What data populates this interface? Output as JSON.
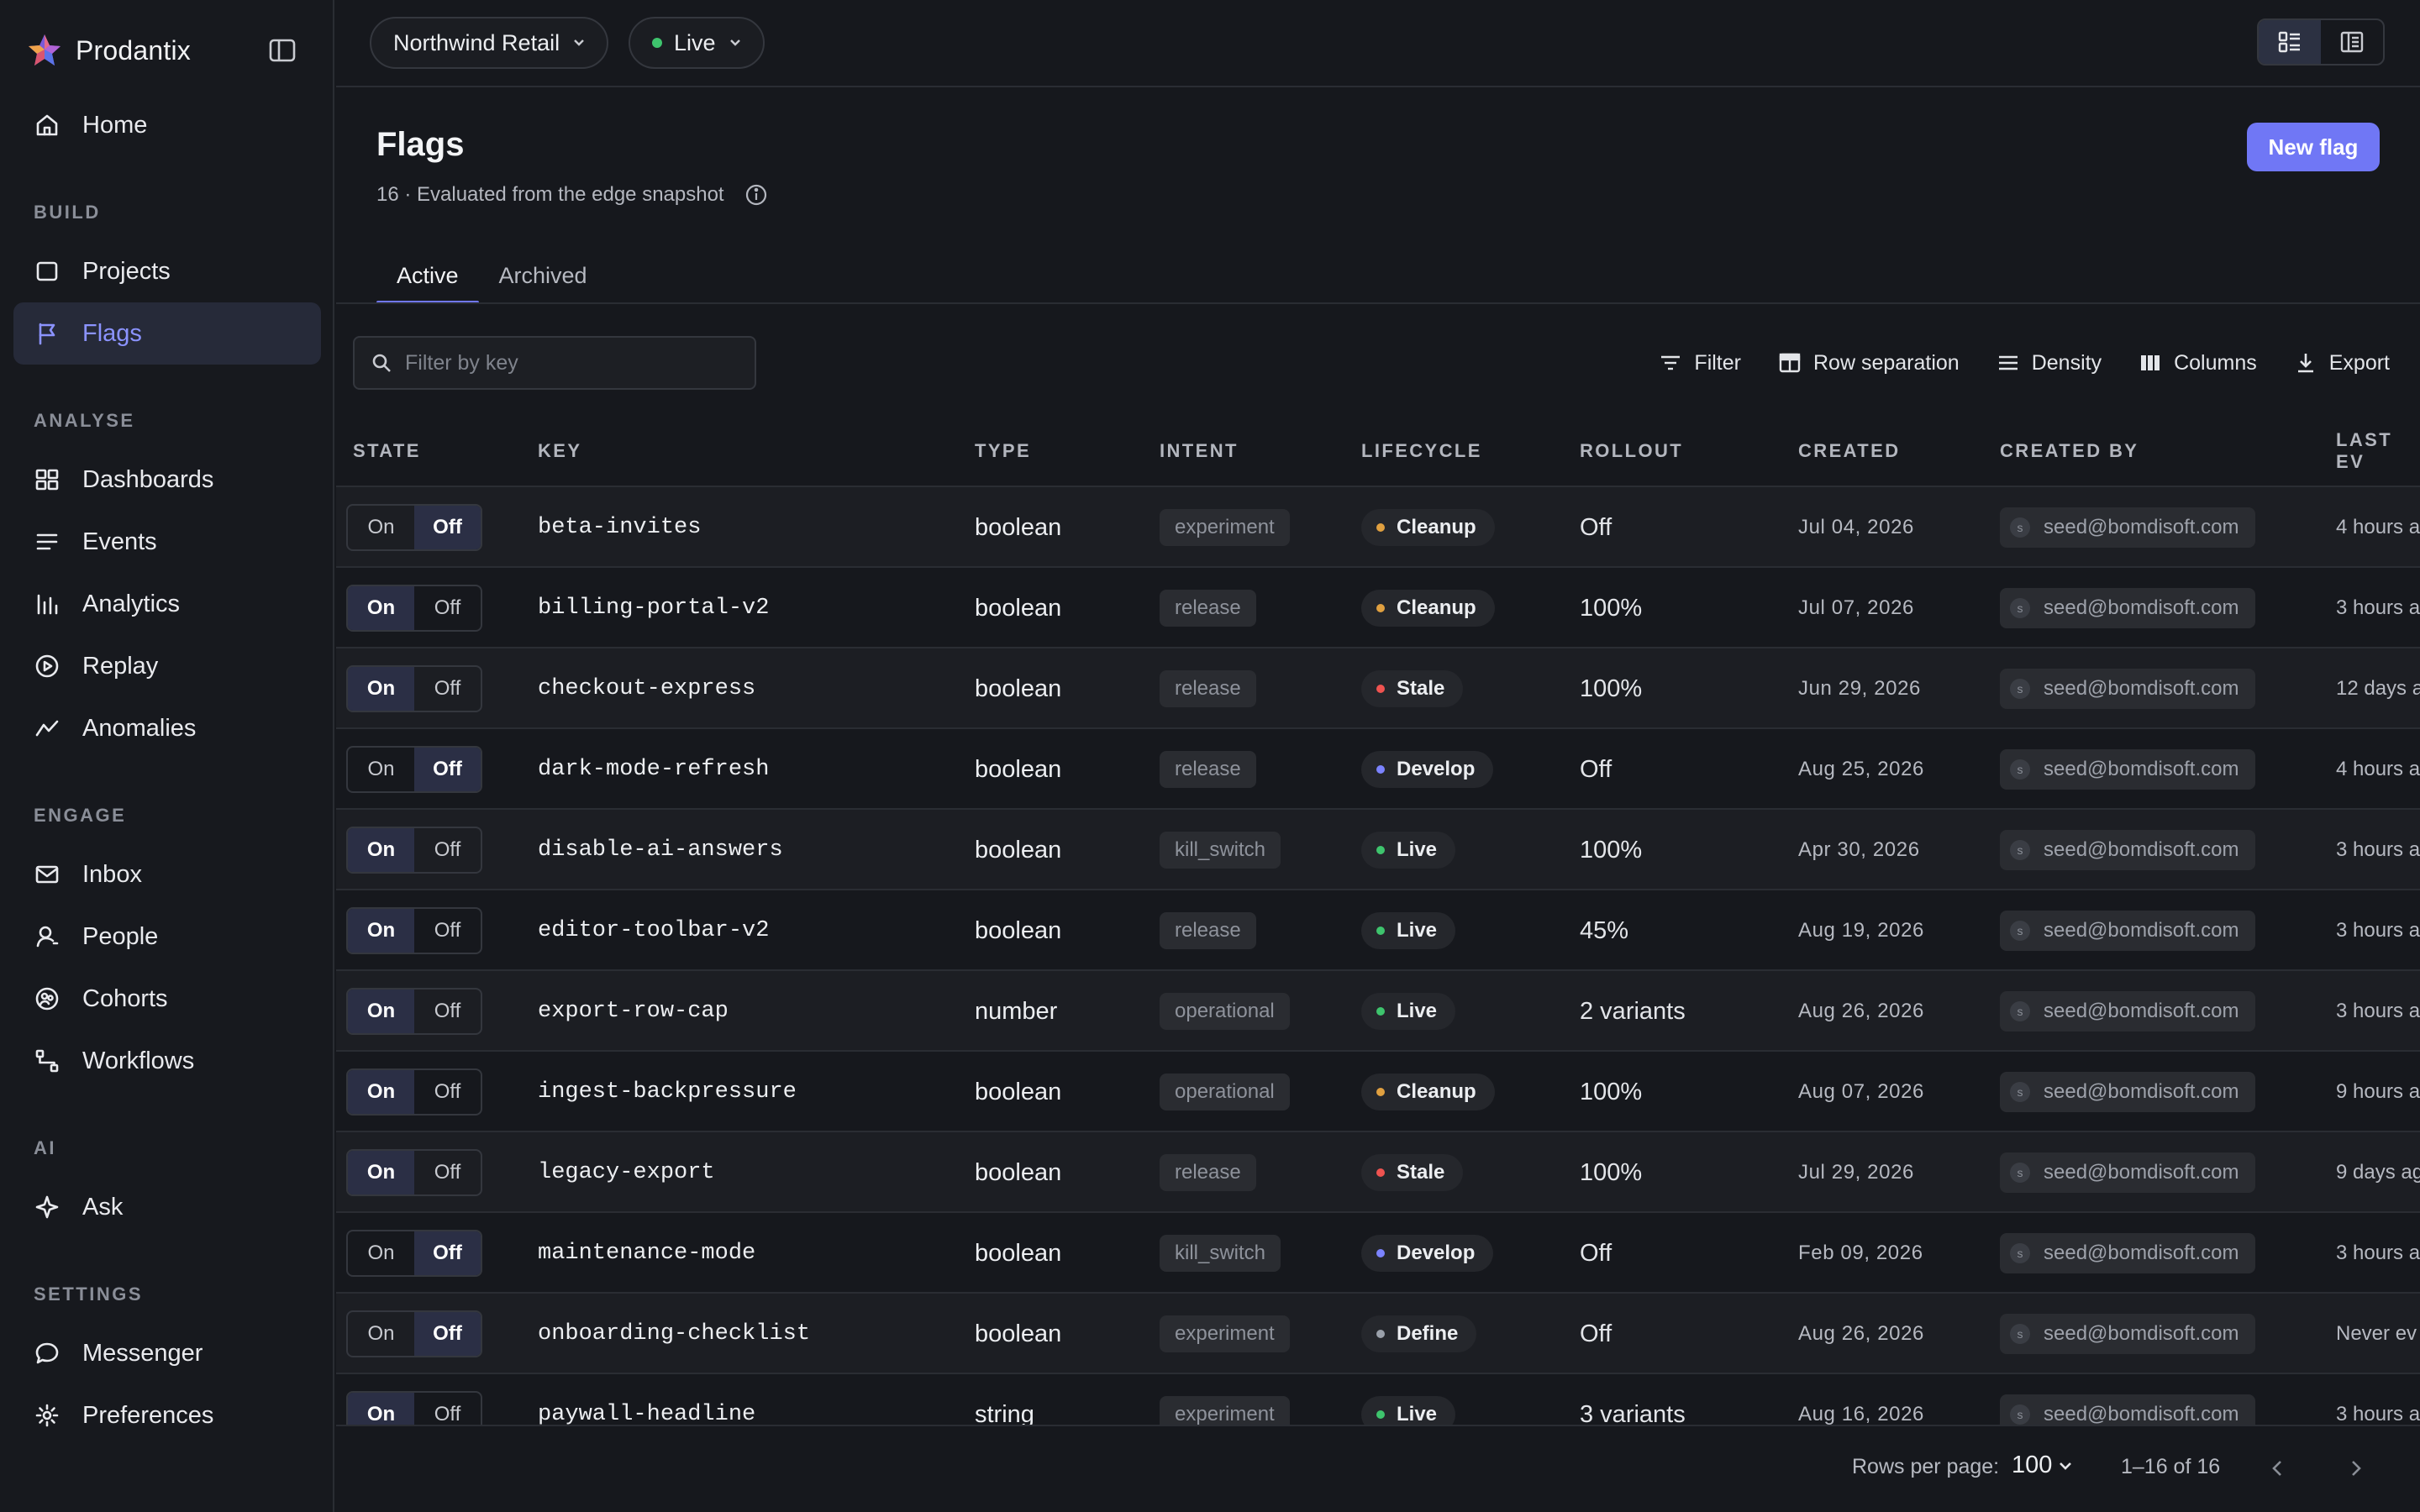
{
  "app": {
    "name": "Prodantix"
  },
  "sidebar": {
    "items": [
      {
        "label": "Home",
        "icon": "home-icon",
        "section": null
      },
      {
        "section_label": "BUILD"
      },
      {
        "label": "Projects",
        "icon": "square-icon"
      },
      {
        "label": "Flags",
        "icon": "flag-icon",
        "active": true
      },
      {
        "section_label": "ANALYSE"
      },
      {
        "label": "Dashboards",
        "icon": "dashboard-icon"
      },
      {
        "label": "Events",
        "icon": "list-icon"
      },
      {
        "label": "Analytics",
        "icon": "bar-chart-icon"
      },
      {
        "label": "Replay",
        "icon": "play-circle-icon"
      },
      {
        "label": "Anomalies",
        "icon": "trend-icon"
      },
      {
        "section_label": "ENGAGE"
      },
      {
        "label": "Inbox",
        "icon": "mail-icon"
      },
      {
        "label": "People",
        "icon": "person-icon"
      },
      {
        "label": "Cohorts",
        "icon": "cohort-icon"
      },
      {
        "label": "Workflows",
        "icon": "workflow-icon"
      },
      {
        "section_label": "AI"
      },
      {
        "label": "Ask",
        "icon": "sparkle-icon"
      },
      {
        "section_label": "SETTINGS"
      },
      {
        "label": "Messenger",
        "icon": "chat-icon"
      },
      {
        "label": "Preferences",
        "icon": "gear-icon"
      }
    ]
  },
  "topbar": {
    "workspace": "Northwind Retail",
    "environment": "Live"
  },
  "page": {
    "title": "Flags",
    "subtitle": "16 · Evaluated from the edge snapshot",
    "new_button": "New flag",
    "tabs": [
      "Active",
      "Archived"
    ],
    "active_tab": "Active"
  },
  "toolbar": {
    "search_placeholder": "Filter by key",
    "filter": "Filter",
    "row_separation": "Row separation",
    "density": "Density",
    "columns": "Columns",
    "export": "Export"
  },
  "table": {
    "headers": {
      "state": "STATE",
      "key": "KEY",
      "type": "TYPE",
      "intent": "INTENT",
      "lifecycle": "LIFECYCLE",
      "rollout": "ROLLOUT",
      "created": "CREATED",
      "created_by": "CREATED BY",
      "last": "LAST EV"
    },
    "state_labels": {
      "on": "On",
      "off": "Off"
    },
    "rows": [
      {
        "state": "off",
        "key": "beta-invites",
        "type": "boolean",
        "intent": "experiment",
        "lifecycle": "Cleanup",
        "rollout": "Off",
        "created": "Jul 04, 2026",
        "created_by": "seed@bomdisoft.com",
        "avatar": "s",
        "last": "4 hours a"
      },
      {
        "state": "on",
        "key": "billing-portal-v2",
        "type": "boolean",
        "intent": "release",
        "lifecycle": "Cleanup",
        "rollout": "100%",
        "created": "Jul 07, 2026",
        "created_by": "seed@bomdisoft.com",
        "avatar": "s",
        "last": "3 hours a"
      },
      {
        "state": "on",
        "key": "checkout-express",
        "type": "boolean",
        "intent": "release",
        "lifecycle": "Stale",
        "rollout": "100%",
        "created": "Jun 29, 2026",
        "created_by": "seed@bomdisoft.com",
        "avatar": "s",
        "last": "12 days a"
      },
      {
        "state": "off",
        "key": "dark-mode-refresh",
        "type": "boolean",
        "intent": "release",
        "lifecycle": "Develop",
        "rollout": "Off",
        "created": "Aug 25, 2026",
        "created_by": "seed@bomdisoft.com",
        "avatar": "s",
        "last": "4 hours a"
      },
      {
        "state": "on",
        "key": "disable-ai-answers",
        "type": "boolean",
        "intent": "kill_switch",
        "lifecycle": "Live",
        "rollout": "100%",
        "created": "Apr 30, 2026",
        "created_by": "seed@bomdisoft.com",
        "avatar": "s",
        "last": "3 hours a"
      },
      {
        "state": "on",
        "key": "editor-toolbar-v2",
        "type": "boolean",
        "intent": "release",
        "lifecycle": "Live",
        "rollout": "45%",
        "created": "Aug 19, 2026",
        "created_by": "seed@bomdisoft.com",
        "avatar": "s",
        "last": "3 hours a"
      },
      {
        "state": "on",
        "key": "export-row-cap",
        "type": "number",
        "intent": "operational",
        "lifecycle": "Live",
        "rollout": "2 variants",
        "created": "Aug 26, 2026",
        "created_by": "seed@bomdisoft.com",
        "avatar": "s",
        "last": "3 hours a"
      },
      {
        "state": "on",
        "key": "ingest-backpressure",
        "type": "boolean",
        "intent": "operational",
        "lifecycle": "Cleanup",
        "rollout": "100%",
        "created": "Aug 07, 2026",
        "created_by": "seed@bomdisoft.com",
        "avatar": "s",
        "last": "9 hours a"
      },
      {
        "state": "on",
        "key": "legacy-export",
        "type": "boolean",
        "intent": "release",
        "lifecycle": "Stale",
        "rollout": "100%",
        "created": "Jul 29, 2026",
        "created_by": "seed@bomdisoft.com",
        "avatar": "s",
        "last": "9 days ag"
      },
      {
        "state": "off",
        "key": "maintenance-mode",
        "type": "boolean",
        "intent": "kill_switch",
        "lifecycle": "Develop",
        "rollout": "Off",
        "created": "Feb 09, 2026",
        "created_by": "seed@bomdisoft.com",
        "avatar": "s",
        "last": "3 hours a"
      },
      {
        "state": "off",
        "key": "onboarding-checklist",
        "type": "boolean",
        "intent": "experiment",
        "lifecycle": "Define",
        "rollout": "Off",
        "created": "Aug 26, 2026",
        "created_by": "seed@bomdisoft.com",
        "avatar": "s",
        "last": "Never ev"
      },
      {
        "state": "on",
        "key": "paywall-headline",
        "type": "string",
        "intent": "experiment",
        "lifecycle": "Live",
        "rollout": "3 variants",
        "created": "Aug 16, 2026",
        "created_by": "seed@bomdisoft.com",
        "avatar": "s",
        "last": "3 hours a"
      }
    ]
  },
  "lifecycle_colors": {
    "Cleanup": "#e0a040",
    "Stale": "#ef5350",
    "Develop": "#7b83ff",
    "Live": "#3ec46d",
    "Define": "#9aa0aa"
  },
  "footer": {
    "rows_per_page_label": "Rows per page:",
    "rows_per_page": "100",
    "range": "1–16 of 16"
  }
}
